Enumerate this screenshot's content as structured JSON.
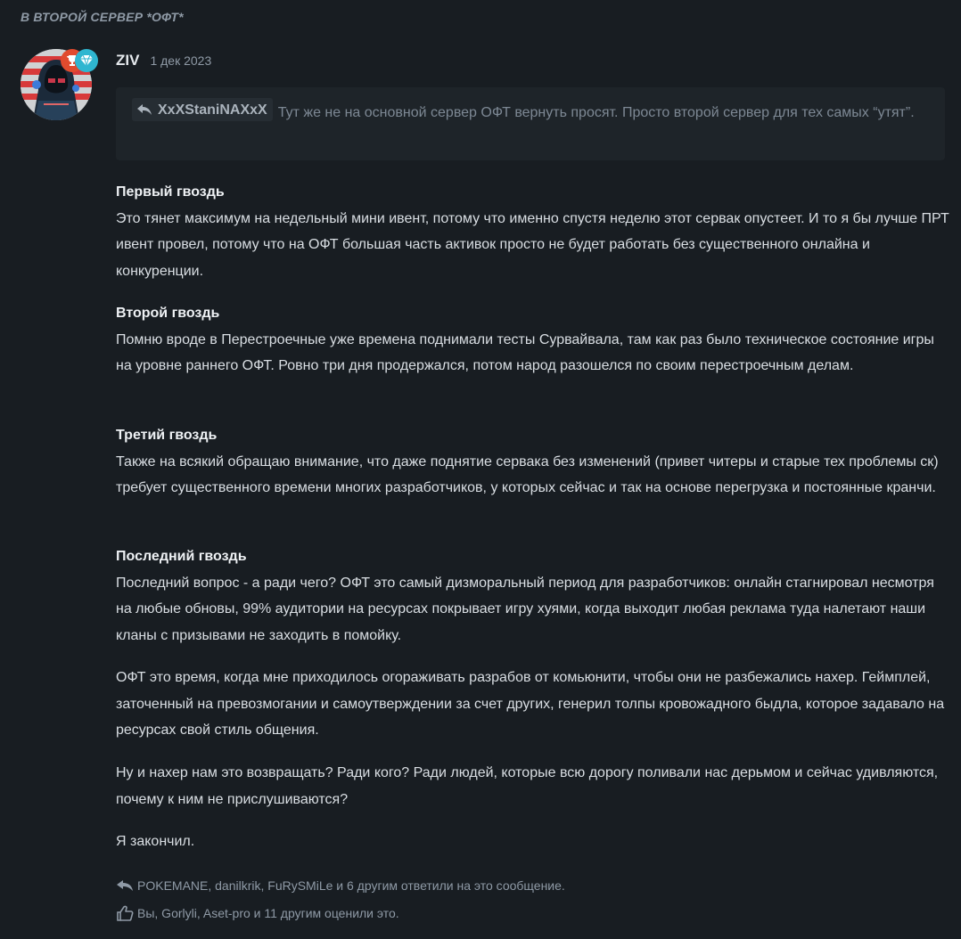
{
  "thread": {
    "heading": "В ВТОРОЙ СЕРВЕР *ОФТ*"
  },
  "post": {
    "author": "ZIV",
    "date": "1 дек 2023",
    "badges": [
      "trophy-badge-icon",
      "diamond-badge-icon"
    ],
    "colors": {
      "trophy_badge": "#e14b2e",
      "diamond_badge": "#2fb6d0"
    },
    "quote": {
      "author": "XxXStaniNAXxX",
      "text": "Тут же не на основной сервер ОФТ вернуть просят. Просто второй сервер для тех самых “утят”."
    },
    "sections": [
      {
        "heading": "Первый гвоздь",
        "text": "Это тянет максимум на недельный мини ивент, потому что именно спустя неделю этот сервак опустеет. И то я бы лучше ПРТ ивент провел, потому что на ОФТ большая часть активок просто не будет работать без существенного онлайна и конкуренции."
      },
      {
        "heading": "Второй гвоздь",
        "text": "Помню вроде в Перестроечные уже времена поднимали тесты Сурвайвала, там как раз было техническое состояние игры на уровне раннего ОФТ. Ровно три дня продержался, потом народ разошелся по своим перестроечным делам."
      },
      {
        "heading": "Третий гвоздь",
        "text": "Также на всякий обращаю внимание, что даже поднятие сервака без изменений (привет читеры и старые тех проблемы ск) требует существенного времени многих разработчиков, у которых сейчас и так на основе перегрузка и постоянные кранчи."
      },
      {
        "heading": "Последний гвоздь",
        "text": "Последний вопрос - а ради чего? ОФТ это самый дизморальный период для разработчиков: онлайн стагнировал несмотря на любые обновы, 99% аудитории на ресурсах покрывает игру хуями, когда выходит любая реклама туда налетают наши кланы с призывами не заходить в помойку."
      }
    ],
    "paragraphs": [
      "ОФТ это время, когда мне приходилось огораживать разрабов от комьюнити, чтобы они не разбежались нахер. Геймплей, заточенный на превозмогании и самоутверждении за счет других, генерил толпы кровожадного быдла, которое задавало на ресурсах свой стиль общения.",
      "Ну и нахер нам это возвращать? Ради кого? Ради людей, которые всю дорогу поливали нас дерьмом и сейчас удивляются, почему к ним не прислушиваются?",
      "Я закончил."
    ],
    "replies": "POKEMANE, danilkrik, FuRySMiLe и 6 другим ответили на это сообщение.",
    "likes": "Вы, Gorlyli, Aset-pro и 11 другим оценили это."
  }
}
